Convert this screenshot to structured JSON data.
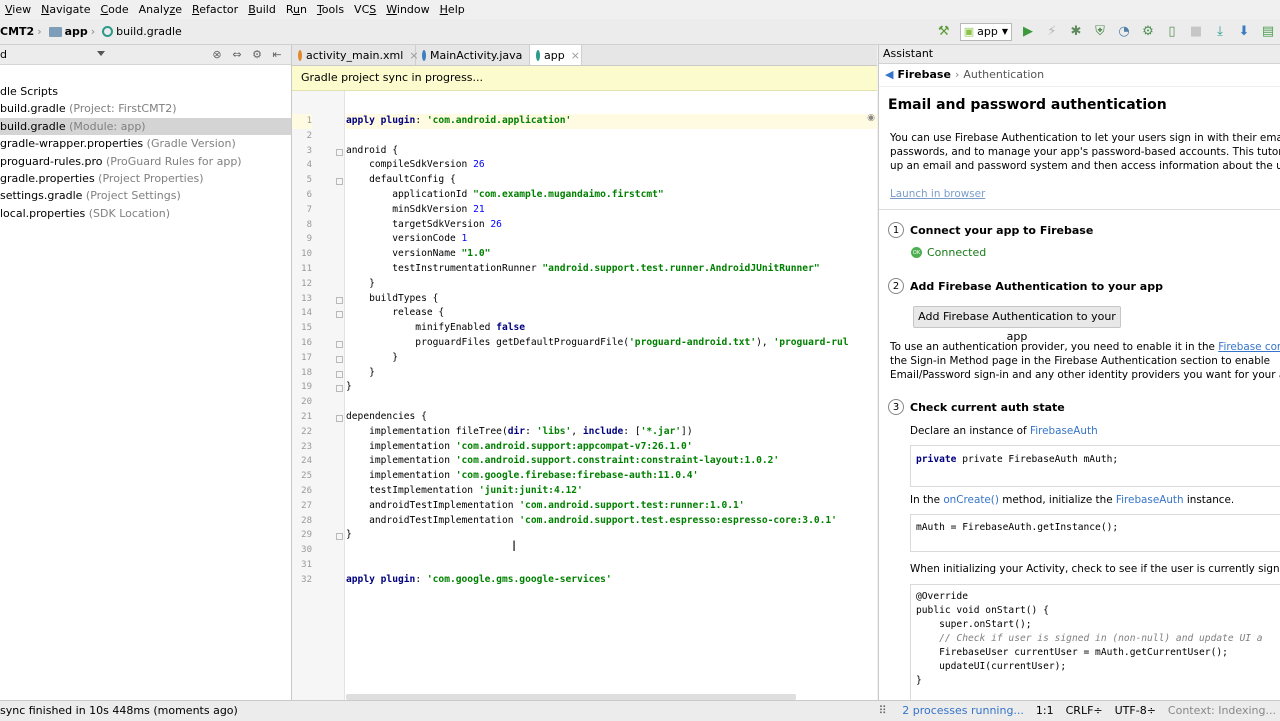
{
  "menu": [
    {
      "pre": "",
      "u": "V",
      "post": "iew"
    },
    {
      "pre": "",
      "u": "N",
      "post": "avigate"
    },
    {
      "pre": "",
      "u": "C",
      "post": "ode"
    },
    {
      "pre": "Analy",
      "u": "z",
      "post": "e"
    },
    {
      "pre": "",
      "u": "R",
      "post": "efactor"
    },
    {
      "pre": "",
      "u": "B",
      "post": "uild"
    },
    {
      "pre": "R",
      "u": "u",
      "post": "n"
    },
    {
      "pre": "",
      "u": "T",
      "post": "ools"
    },
    {
      "pre": "VC",
      "u": "S",
      "post": ""
    },
    {
      "pre": "",
      "u": "W",
      "post": "indow"
    },
    {
      "pre": "",
      "u": "H",
      "post": "elp"
    }
  ],
  "navbar": {
    "crumb1": "CMT2",
    "crumb2": "app",
    "crumb3": "build.gradle",
    "run_config": "app"
  },
  "project": {
    "header": "d",
    "group": "dle Scripts",
    "items": [
      {
        "name": "build.gradle",
        "sub": " (Project: FirstCMT2)",
        "selected": false
      },
      {
        "name": "build.gradle",
        "sub": " (Module: app)",
        "selected": true
      },
      {
        "name": "gradle-wrapper.properties",
        "sub": " (Gradle Version)",
        "selected": false
      },
      {
        "name": "proguard-rules.pro",
        "sub": " (ProGuard Rules for app)",
        "selected": false
      },
      {
        "name": "gradle.properties",
        "sub": " (Project Properties)",
        "selected": false
      },
      {
        "name": "settings.gradle",
        "sub": " (Project Settings)",
        "selected": false
      },
      {
        "name": "local.properties",
        "sub": " (SDK Location)",
        "selected": false
      }
    ]
  },
  "tabs": [
    {
      "label": "activity_main.xml",
      "active": false,
      "color": "#e08a2d"
    },
    {
      "label": "MainActivity.java",
      "active": false,
      "color": "#3f7fbf"
    },
    {
      "label": "app",
      "active": true,
      "color": "#2a9a8c"
    }
  ],
  "banner": "Gradle project sync in progress...",
  "code_lines": [
    [
      [
        "kw",
        "apply plugin"
      ],
      [
        "p",
        ": "
      ],
      [
        "str",
        "'com.android.application'"
      ]
    ],
    [],
    [
      [
        "p",
        "android {"
      ]
    ],
    [
      [
        "p",
        "    compileSdkVersion "
      ],
      [
        "num",
        "26"
      ]
    ],
    [
      [
        "p",
        "    defaultConfig {"
      ]
    ],
    [
      [
        "p",
        "        applicationId "
      ],
      [
        "str",
        "\"com.example.mugandaimo.firstcmt\""
      ]
    ],
    [
      [
        "p",
        "        minSdkVersion "
      ],
      [
        "num",
        "21"
      ]
    ],
    [
      [
        "p",
        "        targetSdkVersion "
      ],
      [
        "num",
        "26"
      ]
    ],
    [
      [
        "p",
        "        versionCode "
      ],
      [
        "num",
        "1"
      ]
    ],
    [
      [
        "p",
        "        versionName "
      ],
      [
        "str",
        "\"1.0\""
      ]
    ],
    [
      [
        "p",
        "        testInstrumentationRunner "
      ],
      [
        "str",
        "\"android.support.test.runner.AndroidJUnitRunner\""
      ]
    ],
    [
      [
        "p",
        "    }"
      ]
    ],
    [
      [
        "p",
        "    buildTypes {"
      ]
    ],
    [
      [
        "p",
        "        release {"
      ]
    ],
    [
      [
        "p",
        "            minifyEnabled "
      ],
      [
        "kw",
        "false"
      ]
    ],
    [
      [
        "p",
        "            proguardFiles getDefaultProguardFile("
      ],
      [
        "str",
        "'proguard-android.txt'"
      ],
      [
        "p",
        "), "
      ],
      [
        "str",
        "'proguard-rul"
      ]
    ],
    [
      [
        "p",
        "        }"
      ]
    ],
    [
      [
        "p",
        "    }"
      ]
    ],
    [
      [
        "p",
        "}"
      ]
    ],
    [],
    [
      [
        "p",
        "dependencies {"
      ]
    ],
    [
      [
        "p",
        "    implementation fileTree("
      ],
      [
        "kw",
        "dir"
      ],
      [
        "p",
        ": "
      ],
      [
        "str",
        "'libs'"
      ],
      [
        "p",
        ", "
      ],
      [
        "kw",
        "include"
      ],
      [
        "p",
        ": ["
      ],
      [
        "str",
        "'*.jar'"
      ],
      [
        "p",
        "])"
      ]
    ],
    [
      [
        "p",
        "    implementation "
      ],
      [
        "str",
        "'com.android.support:appcompat-v7:26.1.0'"
      ]
    ],
    [
      [
        "p",
        "    implementation "
      ],
      [
        "str",
        "'com.android.support.constraint:constraint-layout:1.0.2'"
      ]
    ],
    [
      [
        "p",
        "    implementation "
      ],
      [
        "str",
        "'com.google.firebase:firebase-auth:11.0.4'"
      ]
    ],
    [
      [
        "p",
        "    testImplementation "
      ],
      [
        "str",
        "'junit:junit:4.12'"
      ]
    ],
    [
      [
        "p",
        "    androidTestImplementation "
      ],
      [
        "str",
        "'com.android.support.test:runner:1.0.1'"
      ]
    ],
    [
      [
        "p",
        "    androidTestImplementation "
      ],
      [
        "str",
        "'com.android.support.test.espresso:espresso-core:3.0.1'"
      ]
    ],
    [
      [
        "p",
        "}"
      ]
    ],
    [],
    [],
    [
      [
        "kw",
        "apply plugin"
      ],
      [
        "p",
        ": "
      ],
      [
        "str",
        "'com.google.gms.google-services'"
      ]
    ]
  ],
  "assistant": {
    "header": "Assistant",
    "crumb_root": "Firebase",
    "crumb_leaf": "Authentication",
    "title": "Email and password authentication",
    "intro_lines": [
      "You can use Firebase Authentication to let your users sign in with their email addresse",
      "passwords, and to manage your app's password-based accounts. This tutorial helps y",
      "up an email and password system and then access information about the user."
    ],
    "launch_link": "Launch in browser",
    "step1_num": "1",
    "step1": "Connect your app to Firebase",
    "connected": "Connected",
    "step2_num": "2",
    "step2": "Add Firebase Authentication to your app",
    "step2_button": "Add Firebase Authentication to your app",
    "step2_text_a": "To use an authentication provider, you need to enable it in the ",
    "step2_link": "Firebase console",
    "step2_text_b": ".",
    "step2_line2": "the Sign-in Method page in the Firebase Authentication section to enable",
    "step2_line3": "Email/Password sign-in and any other identity providers you want for your app.",
    "step3_num": "3",
    "step3": "Check current auth state",
    "declare_a": "Declare an instance of ",
    "declare_link": "FirebaseAuth",
    "decl_code": "private FirebaseAuth mAuth;",
    "init_a": "In the ",
    "init_link1": "onCreate()",
    "init_b": " method, initialize the ",
    "init_link2": "FirebaseAuth",
    "init_c": " instance.",
    "init_code": "mAuth = FirebaseAuth.getInstance();",
    "when_text": "When initializing your Activity, check to see if the user is currently signed in.",
    "override_lines": [
      "@Override",
      "public void onStart() {",
      "    super.onStart();",
      "    // Check if user is signed in (non-null) and update UI a",
      "    FirebaseUser currentUser = mAuth.getCurrentUser();",
      "    updateUI(currentUser);",
      "}"
    ]
  },
  "status": {
    "left": "sync finished in 10s 448ms (moments ago)",
    "processes": "2 processes running...",
    "position": "1:1",
    "line_sep": "CRLF÷",
    "encoding": "UTF-8÷",
    "context": "Context: Indexing..."
  }
}
